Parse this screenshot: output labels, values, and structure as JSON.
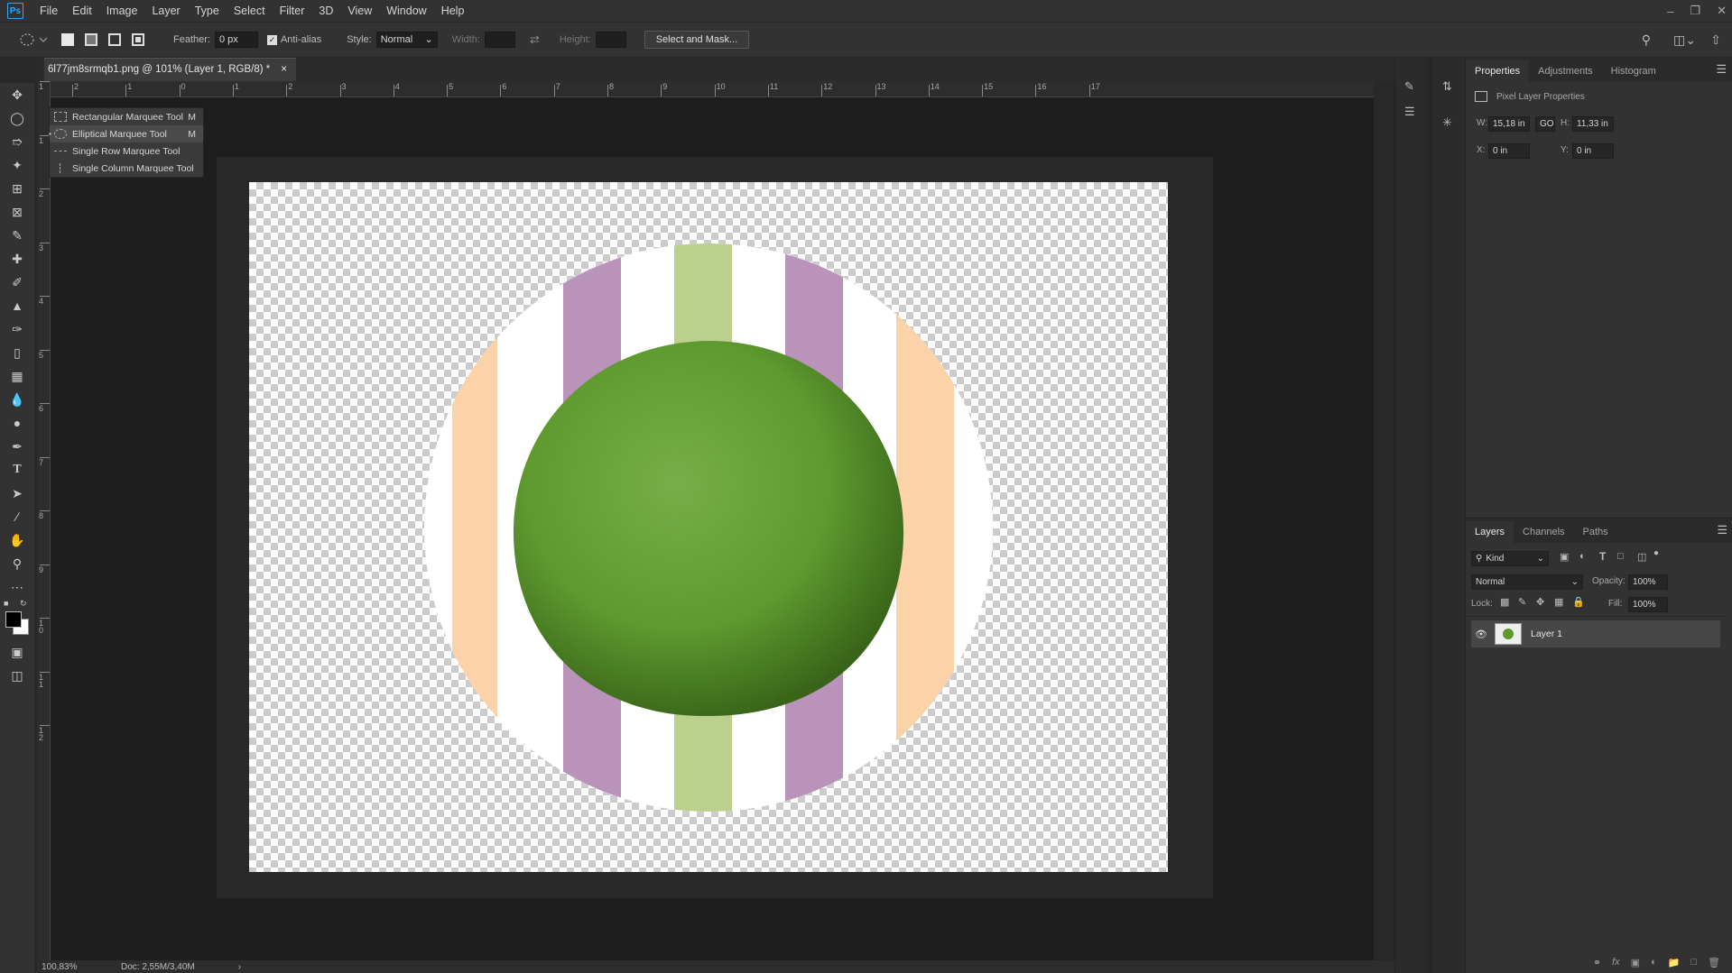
{
  "app": {
    "logo_text": "Ps"
  },
  "menu": [
    "File",
    "Edit",
    "Image",
    "Layer",
    "Type",
    "Select",
    "Filter",
    "3D",
    "View",
    "Window",
    "Help"
  ],
  "options_bar": {
    "feather_label": "Feather:",
    "feather_value": "0 px",
    "anti_alias_label": "Anti-alias",
    "anti_alias_checked": true,
    "style_label": "Style:",
    "style_value": "Normal",
    "width_label": "Width:",
    "height_label": "Height:",
    "select_mask_button": "Select and Mask..."
  },
  "document": {
    "tab_title": "6l77jm8srmqb1.png @ 101% (Layer 1, RGB/8) *",
    "close_glyph": "×"
  },
  "ruler": {
    "h_labels": [
      "2",
      "1",
      "0",
      "1",
      "2",
      "3",
      "4",
      "5",
      "6",
      "7",
      "8",
      "9",
      "10",
      "11",
      "12",
      "13",
      "14",
      "15",
      "16",
      "17"
    ],
    "v_labels": [
      "1",
      "1",
      "2",
      "3",
      "4",
      "5",
      "6",
      "7",
      "8",
      "9",
      "1 0",
      "1 1",
      "1 2"
    ]
  },
  "tool_flyout": {
    "items": [
      {
        "label": "Rectangular Marquee Tool",
        "key": "M",
        "selected": false
      },
      {
        "label": "Elliptical Marquee Tool",
        "key": "M",
        "selected": true
      },
      {
        "label": "Single Row Marquee Tool",
        "key": "",
        "selected": false
      },
      {
        "label": "Single Column Marquee Tool",
        "key": "",
        "selected": false
      }
    ]
  },
  "status": {
    "zoom": "100,83%",
    "doc": "Doc: 2,55M/3,40M",
    "arrow": "›"
  },
  "properties_panel": {
    "tabs": [
      "Properties",
      "Adjustments",
      "Histogram"
    ],
    "active_tab": "Properties",
    "section_title": "Pixel Layer Properties",
    "w_label": "W:",
    "w_value": "15,18 in",
    "link_label": "GO",
    "h_label": "H:",
    "h_value": "11,33 in",
    "x_label": "X:",
    "x_value": "0 in",
    "y_label": "Y:",
    "y_value": "0 in"
  },
  "layers_panel": {
    "tabs": [
      "Layers",
      "Channels",
      "Paths"
    ],
    "active_tab": "Layers",
    "filter_value": "Kind",
    "blend_mode": "Normal",
    "opacity_label": "Opacity:",
    "opacity_value": "100%",
    "lock_label": "Lock:",
    "fill_label": "Fill:",
    "fill_value": "100%",
    "layers": [
      {
        "name": "Layer 1",
        "visible": true
      }
    ]
  },
  "colors": {
    "stripe_peach": "#fcd3a9",
    "stripe_purple": "#b993ba",
    "stripe_green": "#bcd08e",
    "macaron_green": "#5c9a2c"
  }
}
